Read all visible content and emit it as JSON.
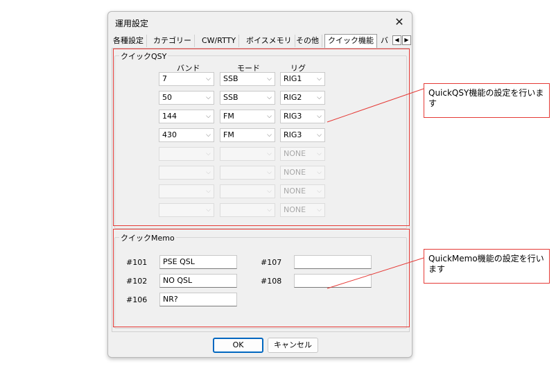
{
  "dialog": {
    "title": "運用設定",
    "close_icon": "close-icon",
    "tabs": [
      "各種設定",
      "カテゴリー",
      "CW/RTTY",
      "ボイスメモリ",
      "その他",
      "クイック機能",
      "バ"
    ],
    "active_tab_index": 5
  },
  "quickqsy": {
    "group_label": "クイックQSY",
    "headers": {
      "band": "バンド",
      "mode": "モード",
      "rig": "リグ"
    },
    "rows": [
      {
        "band": "7",
        "mode": "SSB",
        "rig": "RIG1",
        "enabled": true
      },
      {
        "band": "50",
        "mode": "SSB",
        "rig": "RIG2",
        "enabled": true
      },
      {
        "band": "144",
        "mode": "FM",
        "rig": "RIG3",
        "enabled": true
      },
      {
        "band": "430",
        "mode": "FM",
        "rig": "RIG3",
        "enabled": true
      },
      {
        "band": "",
        "mode": "",
        "rig": "NONE",
        "enabled": false
      },
      {
        "band": "",
        "mode": "",
        "rig": "NONE",
        "enabled": false
      },
      {
        "band": "",
        "mode": "",
        "rig": "NONE",
        "enabled": false
      },
      {
        "band": "",
        "mode": "",
        "rig": "NONE",
        "enabled": false
      }
    ]
  },
  "quickmemo": {
    "group_label": "クイックMemo",
    "items": [
      {
        "label": "#101",
        "value": "PSE QSL"
      },
      {
        "label": "#102",
        "value": "NO QSL"
      },
      {
        "label": "#106",
        "value": "NR?"
      },
      {
        "label": "#107",
        "value": ""
      },
      {
        "label": "#108",
        "value": ""
      }
    ]
  },
  "buttons": {
    "ok": "OK",
    "cancel": "キャンセル"
  },
  "annotations": {
    "qsy_note": "QuickQSY機能の設定を行います",
    "memo_note": "QuickMemo機能の設定を行います"
  },
  "colors": {
    "highlight": "#e53935",
    "default_button_border": "#0067c0"
  }
}
